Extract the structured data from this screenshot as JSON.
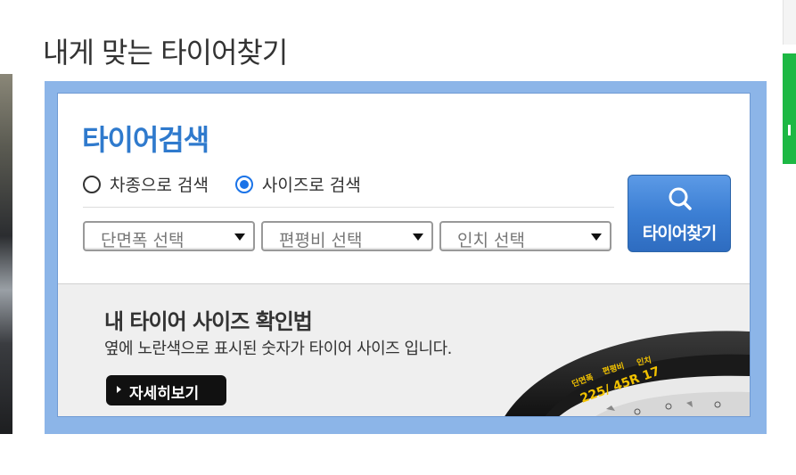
{
  "page_title": "내게 맞는 타이어찾기",
  "search": {
    "title": "타이어검색",
    "radio_options": [
      {
        "label": "차종으로 검색",
        "checked": false
      },
      {
        "label": "사이즈로 검색",
        "checked": true
      }
    ],
    "selects": [
      {
        "selected": "단면폭 선택"
      },
      {
        "selected": "편평비 선택"
      },
      {
        "selected": "인치 선택"
      }
    ],
    "find_button": {
      "label": "타이어찾기",
      "icon": "search-icon"
    }
  },
  "size_guide": {
    "title": "내 타이어 사이즈 확인법",
    "description": "옆에 노란색으로 표시된 숫자가 타이어 사이즈 입니다.",
    "detail_button": "자세히보기",
    "tire_labels": {
      "width_label": "단면폭",
      "ratio_label": "편평비",
      "inch_label": "인치",
      "size_text": "225/ 45R 17"
    }
  },
  "colors": {
    "accent_blue": "#2f7acd",
    "frame_blue": "#8cb5e8",
    "size_yellow": "#f2c200",
    "side_green": "#1db844"
  }
}
